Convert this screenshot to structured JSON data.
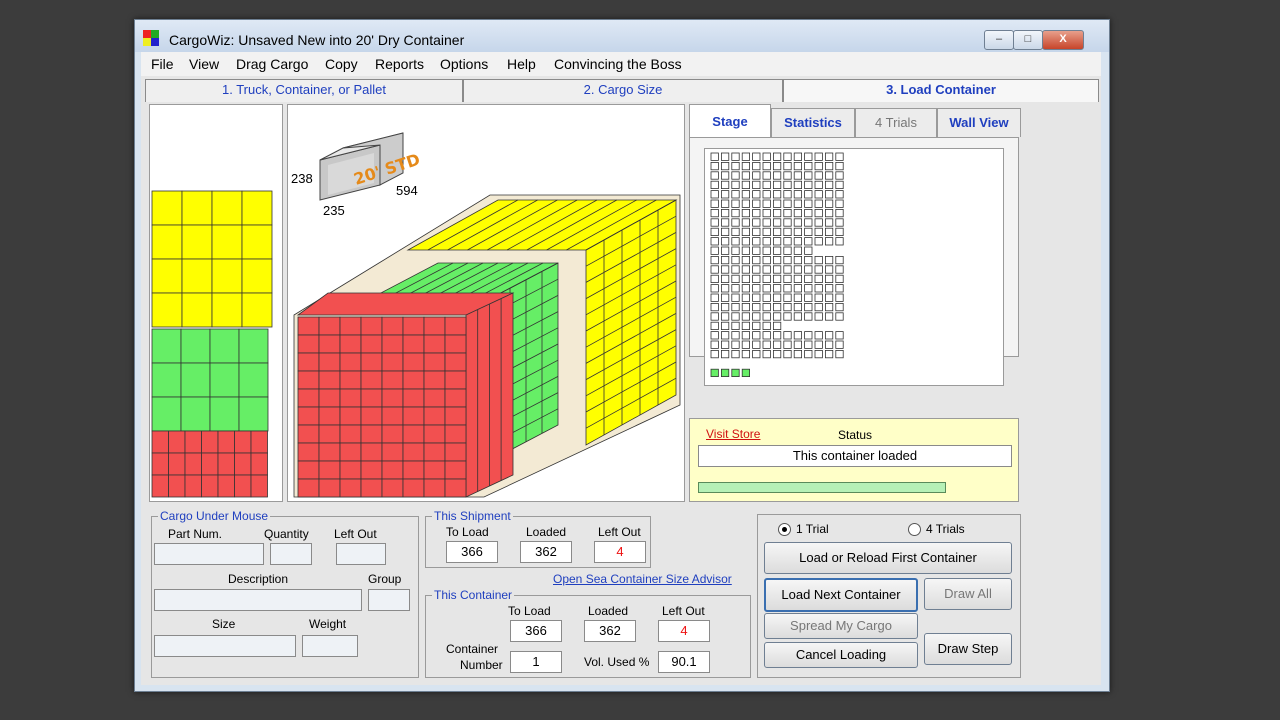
{
  "window": {
    "title": "CargoWiz:  Unsaved New into  20' Dry Container",
    "minimize_glyph": "–",
    "maximize_glyph": "□",
    "close_glyph": "X"
  },
  "menu": [
    "File",
    "View",
    "Drag Cargo",
    "Copy",
    "Reports",
    "Options",
    "Help",
    "Convincing the Boss"
  ],
  "tabs": [
    {
      "label": "1. Truck, Container, or Pallet"
    },
    {
      "label": "2. Cargo Size"
    },
    {
      "label": "3. Load Container"
    }
  ],
  "container_icon": {
    "label": "20' STD",
    "height": "238",
    "width": "235",
    "length": "594"
  },
  "cargo_colors": {
    "yellow": "#ffff00",
    "green": "#66ee66",
    "red": "#f25050"
  },
  "right_tabs": [
    {
      "label": "Stage"
    },
    {
      "label": "Statistics"
    },
    {
      "label": "4 Trials"
    },
    {
      "label": "Wall View"
    }
  ],
  "status": {
    "visit_store": "Visit Store",
    "label": "Status",
    "message": "This container loaded",
    "progress": 1.0
  },
  "cargo_under_mouse": {
    "title": "Cargo Under Mouse",
    "part_num_label": "Part Num.",
    "quantity_label": "Quantity",
    "left_out_label": "Left Out",
    "description_label": "Description",
    "group_label": "Group",
    "size_label": "Size",
    "weight_label": "Weight"
  },
  "this_shipment": {
    "title": "This Shipment",
    "to_load_label": "To Load",
    "loaded_label": "Loaded",
    "left_out_label": "Left Out",
    "to_load": "366",
    "loaded": "362",
    "left_out": "4"
  },
  "advisor_link": "Open Sea Container Size Advisor",
  "this_container": {
    "title": "This Container",
    "to_load_label": "To Load",
    "loaded_label": "Loaded",
    "left_out_label": "Left Out",
    "to_load": "366",
    "loaded": "362",
    "left_out": "4",
    "container_label": "Container",
    "number_label": "Number",
    "number": "1",
    "vol_used_label": "Vol. Used %",
    "vol_used": "90.1"
  },
  "controls": {
    "trial1": "1 Trial",
    "trial4": "4 Trials",
    "load_first": "Load or Reload First Container",
    "load_next": "Load Next Container",
    "draw_all": "Draw All",
    "spread": "Spread My Cargo",
    "cancel": "Cancel Loading",
    "draw_step": "Draw Step"
  }
}
